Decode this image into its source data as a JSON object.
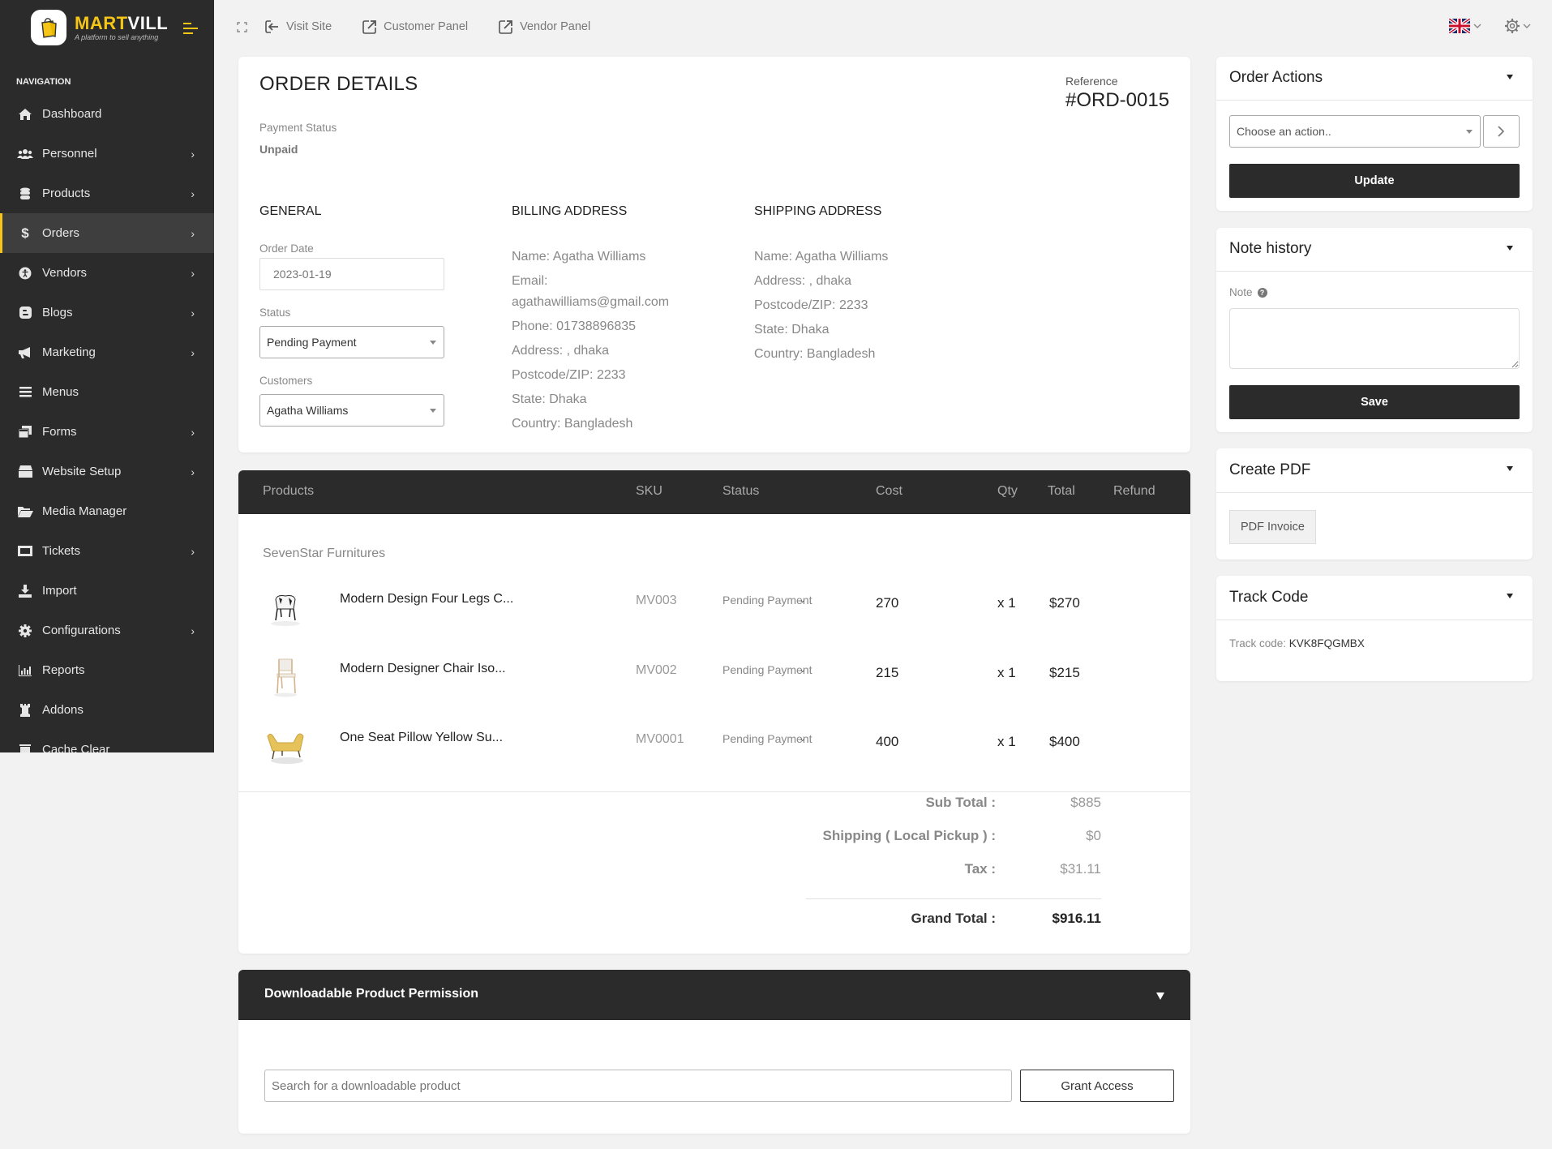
{
  "brand": {
    "name_a": "MART",
    "name_b": "VILL",
    "tagline": "A platform to sell anything",
    "accent": "#f5c518",
    "dark": "#2b2b2b"
  },
  "sidebar": {
    "title": "NAVIGATION",
    "items": [
      {
        "label": "Dashboard",
        "icon": "home-icon",
        "has_children": false
      },
      {
        "label": "Personnel",
        "icon": "users-icon",
        "has_children": true
      },
      {
        "label": "Products",
        "icon": "database-icon",
        "has_children": true
      },
      {
        "label": "Orders",
        "icon": "dollar-icon",
        "has_children": true,
        "active": true
      },
      {
        "label": "Vendors",
        "icon": "accessibility-icon",
        "has_children": true
      },
      {
        "label": "Blogs",
        "icon": "blogger-icon",
        "has_children": true
      },
      {
        "label": "Marketing",
        "icon": "bullhorn-icon",
        "has_children": true
      },
      {
        "label": "Menus",
        "icon": "bars-icon",
        "has_children": false
      },
      {
        "label": "Forms",
        "icon": "forms-icon",
        "has_children": true
      },
      {
        "label": "Website Setup",
        "icon": "archive-icon",
        "has_children": true
      },
      {
        "label": "Media Manager",
        "icon": "folder-open-icon",
        "has_children": false
      },
      {
        "label": "Tickets",
        "icon": "ticket-icon",
        "has_children": true
      },
      {
        "label": "Import",
        "icon": "download-icon",
        "has_children": false
      },
      {
        "label": "Configurations",
        "icon": "cog-icon",
        "has_children": true
      },
      {
        "label": "Reports",
        "icon": "bar-chart-icon",
        "has_children": false
      },
      {
        "label": "Addons",
        "icon": "chess-rook-icon",
        "has_children": false
      },
      {
        "label": "Cache Clear",
        "icon": "trash-icon",
        "has_children": false
      }
    ]
  },
  "topbar": {
    "links": [
      {
        "label": "Visit Site",
        "icon": "sign-in-icon"
      },
      {
        "label": "Customer Panel",
        "icon": "external-link-icon"
      },
      {
        "label": "Vendor Panel",
        "icon": "external-link-icon"
      }
    ],
    "language": "UK flag"
  },
  "order": {
    "title": "ORDER DETAILS",
    "reference_label": "Reference",
    "reference": "#ORD-0015",
    "payment_status_label": "Payment Status",
    "payment_status": "Unpaid",
    "general": {
      "heading": "GENERAL",
      "order_date_label": "Order Date",
      "order_date": "2023-01-19",
      "status_label": "Status",
      "status": "Pending Payment",
      "customers_label": "Customers",
      "customer": "Agatha Williams"
    },
    "billing": {
      "heading": "BILLING ADDRESS",
      "lines": [
        "Name: Agatha Williams",
        "Email: agathawilliams@gmail.com",
        "Phone: 01738896835",
        "Address: , dhaka",
        "Postcode/ZIP: 2233",
        "State: Dhaka",
        "Country: Bangladesh"
      ]
    },
    "shipping": {
      "heading": "SHIPPING ADDRESS",
      "lines": [
        "Name: Agatha Williams",
        "Address: , dhaka",
        "Postcode/ZIP: 2233",
        "State: Dhaka",
        "Country: Bangladesh"
      ]
    }
  },
  "products": {
    "columns": [
      "Products",
      "SKU",
      "Status",
      "Cost",
      "Qty",
      "Total",
      "Refund"
    ],
    "vendor": "SevenStar Furnitures",
    "rows": [
      {
        "name": "Modern Design Four Legs C...",
        "sku": "MV003",
        "status": "Pending Payment",
        "cost": "270",
        "qty": "x 1",
        "total": "$270",
        "image": "black-white-armchair"
      },
      {
        "name": "Modern Designer Chair Iso...",
        "sku": "MV002",
        "status": "Pending Payment",
        "cost": "215",
        "qty": "x 1",
        "total": "$215",
        "image": "white-wood-chair"
      },
      {
        "name": "One Seat Pillow Yellow Su...",
        "sku": "MV0001",
        "status": "Pending Payment",
        "cost": "400",
        "qty": "x 1",
        "total": "$400",
        "image": "yellow-sofa-chair"
      }
    ],
    "totals": {
      "subtotal_label": "Sub Total :",
      "subtotal": "$885",
      "shipping_label": "Shipping ( Local Pickup ) :",
      "shipping": "$0",
      "tax_label": "Tax :",
      "tax": "$31.11",
      "grand_label": "Grand Total :",
      "grand": "$916.11"
    }
  },
  "downloadable": {
    "title": "Downloadable Product Permission",
    "search_placeholder": "Search for a downloadable product",
    "grant_label": "Grant Access"
  },
  "order_actions": {
    "title": "Order Actions",
    "placeholder": "Choose an action..",
    "update_label": "Update"
  },
  "note_history": {
    "title": "Note history",
    "note_label": "Note",
    "note_value": "",
    "save_label": "Save"
  },
  "create_pdf": {
    "title": "Create PDF",
    "button_label": "PDF Invoice"
  },
  "track_code": {
    "title": "Track Code",
    "label": "Track code:",
    "value": "KVK8FQGMBX"
  }
}
